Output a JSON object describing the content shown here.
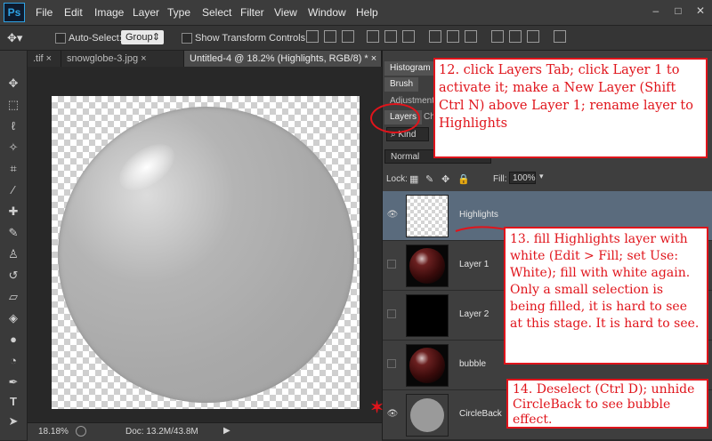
{
  "app": {
    "logo": "Ps"
  },
  "menu": [
    "File",
    "Edit",
    "Image",
    "Layer",
    "Type",
    "Select",
    "Filter",
    "View",
    "Window",
    "Help"
  ],
  "window_controls": [
    "–",
    "□",
    "✕"
  ],
  "options": {
    "auto_select": "Auto-Select:",
    "group": "Group",
    "show_transform": "Show Transform Controls"
  },
  "doc_tabs": [
    {
      "label": ".tif ×"
    },
    {
      "label": "snowglobe-3.jpg ×"
    },
    {
      "label": "Untitled-4 @ 18.2% (Highlights, RGB/8) * ×"
    }
  ],
  "status": {
    "zoom": "18.18%",
    "doc": "Doc: 13.2M/43.8M"
  },
  "panels": {
    "histogram_tab": "Histogram",
    "brush_tab": "Brush",
    "adjustments_tab": "Adjustments",
    "layers_tab": "Layers",
    "channels_tab": "Cha",
    "kind": "Kind",
    "blend_mode": "Normal",
    "lock_label": "Lock:",
    "fill_label": "Fill:",
    "fill_value": "100%"
  },
  "layers": [
    {
      "name": "Highlights",
      "visible": true,
      "selected": true
    },
    {
      "name": "Layer 1",
      "visible": false
    },
    {
      "name": "Layer 2",
      "visible": false
    },
    {
      "name": "bubble",
      "visible": false
    },
    {
      "name": "CircleBack",
      "visible": true
    }
  ],
  "annotations": {
    "step12": "12. click Layers Tab; click Layer 1 to activate it; make a New Layer (Shift Ctrl N) above Layer 1; rename layer to Highlights",
    "step13": "13. fill Highlights layer with white (Edit > Fill; set Use: White); fill with white again. Only a small selection is being filled, it is hard to see at this stage. It is hard to see.",
    "step14": "14. Deselect (Ctrl D); unhide CircleBack to see bubble effect."
  },
  "colors": {
    "annotation": "#e0141b",
    "selected_layer": "#5a6b7d",
    "accent": "#2fa3e6"
  }
}
